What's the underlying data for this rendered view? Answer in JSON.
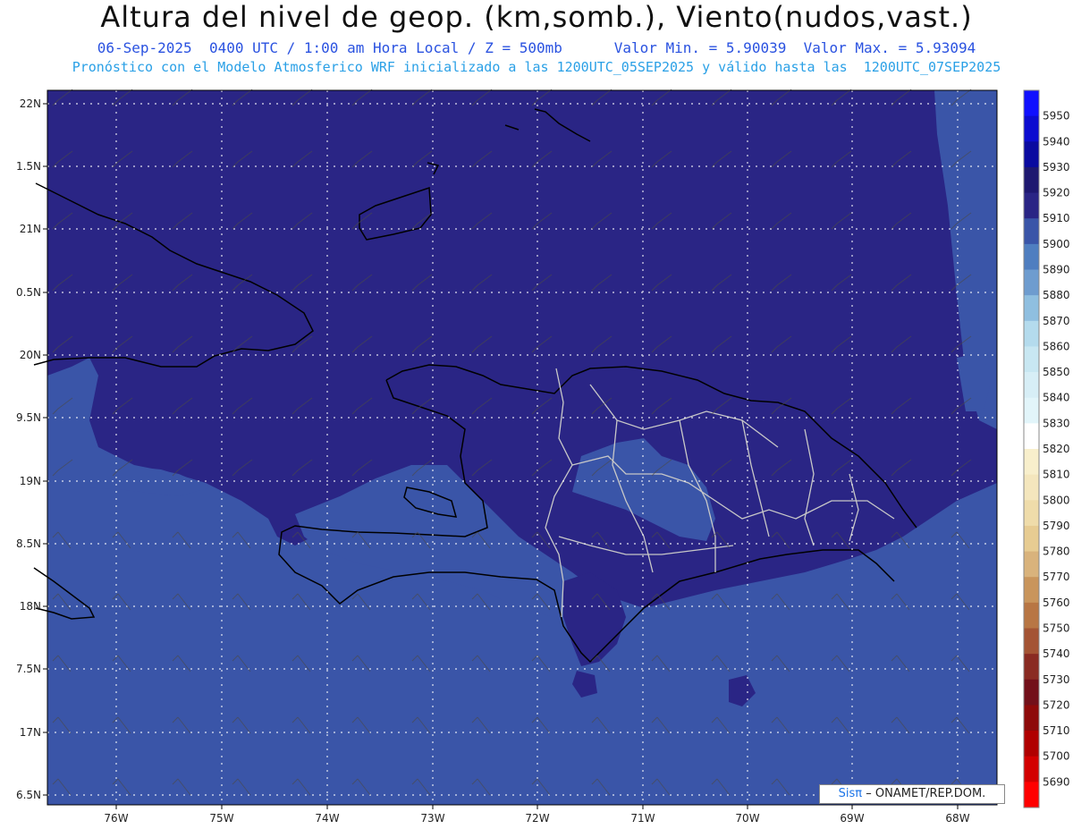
{
  "header": {
    "title": "Altura del nivel de geop. (km,somb.), Viento(nudos,vast.)",
    "subtitle_left": "06-Sep-2025  0400 UTC / 1:00 am Hora Local / Z = 500mb",
    "subtitle_right": "Valor Min. = 5.90039  Valor Max. = 5.93094",
    "model_line": "Pronóstico con el Modelo Atmosferico WRF inicializado a las 1200UTC_05SEP2025 y válido hasta las  1200UTC_07SEP2025"
  },
  "axes": {
    "lat_labels": [
      "22N",
      "1.5N",
      "21N",
      "0.5N",
      "20N",
      "9.5N",
      "19N",
      "8.5N",
      "18N",
      "7.5N",
      "17N",
      "6.5N"
    ],
    "lon_labels": [
      "76W",
      "75W",
      "74W",
      "73W",
      "72W",
      "71W",
      "70W",
      "69W",
      "68W"
    ]
  },
  "colorbar": {
    "labels": [
      "5950",
      "5940",
      "5930",
      "5920",
      "5910",
      "5900",
      "5890",
      "5880",
      "5870",
      "5860",
      "5850",
      "5840",
      "5830",
      "5820",
      "5810",
      "5800",
      "5790",
      "5780",
      "5770",
      "5760",
      "5750",
      "5740",
      "5730",
      "5720",
      "5710",
      "5700",
      "5690"
    ],
    "colors": [
      "#1010ff",
      "#0c0cd0",
      "#0a0aa0",
      "#1e1870",
      "#2a2585",
      "#3a55a8",
      "#4f7ec0",
      "#6e9ccf",
      "#8fbfe0",
      "#b4dbed",
      "#c8e7f2",
      "#d7eef6",
      "#e2f5fa",
      "#ffffff",
      "#f8efcc",
      "#f4e6bd",
      "#efdcaa",
      "#e7cc92",
      "#d9b37c",
      "#c9955c",
      "#b87644",
      "#a45434",
      "#8a2b22",
      "#73101a",
      "#8e0a0a",
      "#b00000",
      "#d30000",
      "#ff0000"
    ]
  },
  "field_colors": {
    "level_5910": "#2a2585",
    "level_5900": "#3a55a8",
    "coastline": "#000000",
    "provinces": "#c8c8c8"
  },
  "credit": {
    "brand": "Sisπ",
    "text": "–  ONAMET/REP.DOM."
  }
}
